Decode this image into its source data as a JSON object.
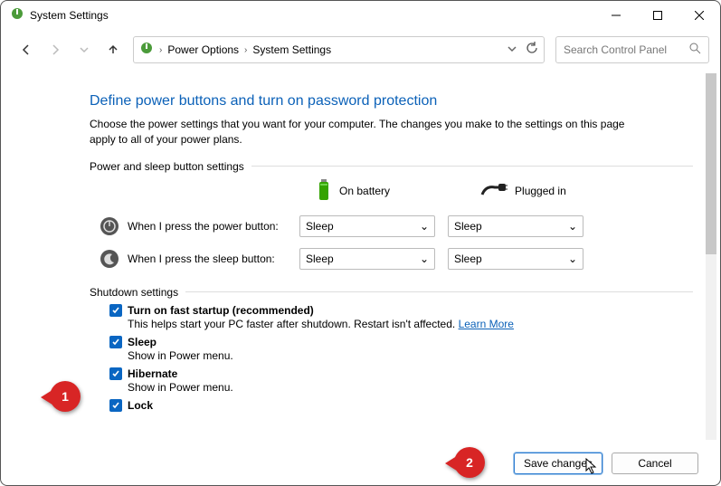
{
  "window": {
    "title": "System Settings"
  },
  "breadcrumb": {
    "seg1": "Power Options",
    "seg2": "System Settings"
  },
  "search": {
    "placeholder": "Search Control Panel"
  },
  "page": {
    "heading": "Define power buttons and turn on password protection",
    "description": "Choose the power settings that you want for your computer. The changes you make to the settings on this page apply to all of your power plans."
  },
  "sections": {
    "powerSleep": {
      "label": "Power and sleep button settings",
      "columns": {
        "battery": "On battery",
        "plugged": "Plugged in"
      },
      "rows": [
        {
          "label": "When I press the power button:",
          "battery": "Sleep",
          "plugged": "Sleep"
        },
        {
          "label": "When I press the sleep button:",
          "battery": "Sleep",
          "plugged": "Sleep"
        }
      ]
    },
    "shutdown": {
      "label": "Shutdown settings",
      "items": [
        {
          "label": "Turn on fast startup (recommended)",
          "desc": "This helps start your PC faster after shutdown. Restart isn't affected.",
          "link": "Learn More"
        },
        {
          "label": "Sleep",
          "desc": "Show in Power menu."
        },
        {
          "label": "Hibernate",
          "desc": "Show in Power menu."
        },
        {
          "label": "Lock"
        }
      ]
    }
  },
  "footer": {
    "save": "Save changes",
    "cancel": "Cancel"
  },
  "annotations": {
    "b1": "1",
    "b2": "2"
  }
}
